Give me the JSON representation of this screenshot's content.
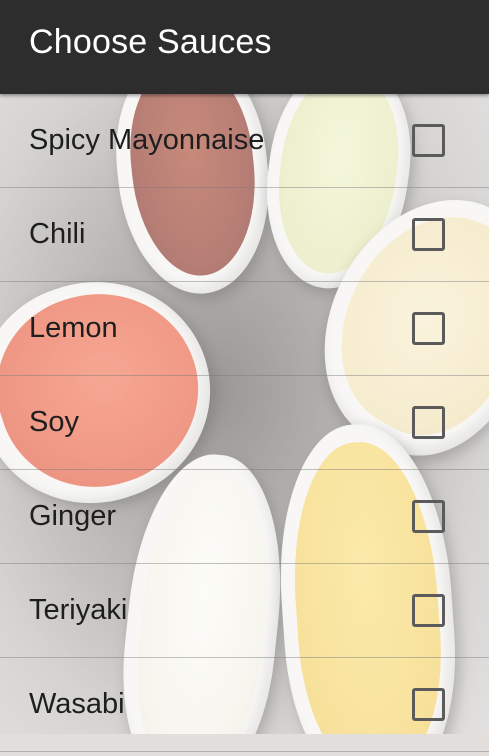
{
  "app_bar": {
    "title": "Choose Sauces"
  },
  "sauces": [
    {
      "label": "Spicy Mayonnaise",
      "checked": false
    },
    {
      "label": "Chili",
      "checked": false
    },
    {
      "label": "Lemon",
      "checked": false
    },
    {
      "label": "Soy",
      "checked": false
    },
    {
      "label": "Ginger",
      "checked": false
    },
    {
      "label": "Teriyaki",
      "checked": false
    },
    {
      "label": "Wasabi",
      "checked": false
    }
  ],
  "colors": {
    "app_bar": "#2d2d2d",
    "title_text": "#ffffff",
    "label_text": "#1e1e1e",
    "checkbox_border": "#5b5b5b"
  }
}
